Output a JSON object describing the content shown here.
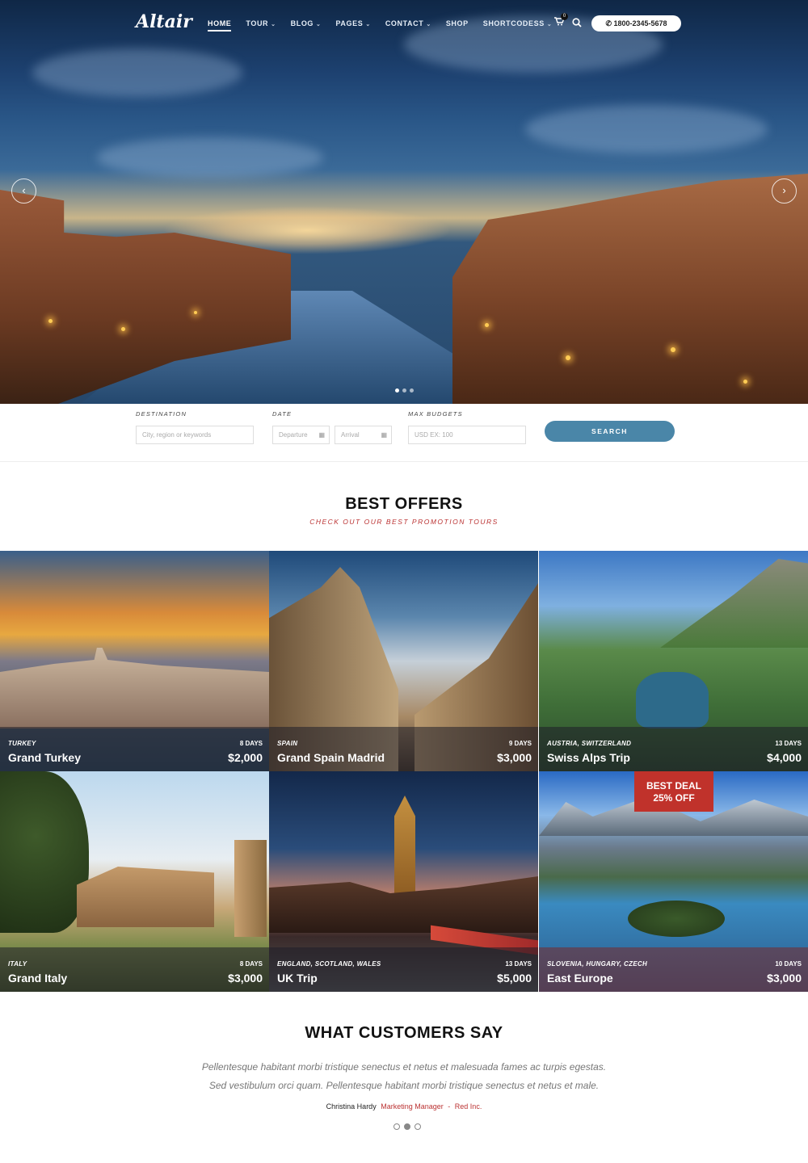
{
  "brand": {
    "logo": "Altair"
  },
  "nav": {
    "items": [
      {
        "label": "HOME",
        "active": true,
        "caret": false
      },
      {
        "label": "TOUR",
        "caret": true
      },
      {
        "label": "BLOG",
        "caret": true
      },
      {
        "label": "PAGES",
        "caret": true
      },
      {
        "label": "CONTACT",
        "caret": true
      },
      {
        "label": "SHOP",
        "caret": false
      },
      {
        "label": "SHORTCODESS",
        "caret": true
      }
    ],
    "cart_count": "0",
    "phone": "1800-2345-5678"
  },
  "slider": {
    "prev_icon": "chevron-left-icon",
    "next_icon": "chevron-right-icon",
    "slides": 3,
    "active_slide": 1
  },
  "search": {
    "destination_label": "DESTINATION",
    "destination_placeholder": "City, region or keywords",
    "date_label": "DATE",
    "departure_placeholder": "Departure",
    "arrival_placeholder": "Arrival",
    "budget_label": "MAX BUDGETS",
    "budget_placeholder": "USD EX: 100",
    "button": "SEARCH"
  },
  "offers": {
    "title": "BEST OFFERS",
    "subtitle": "CHECK OUT OUR BEST PROMOTION TOURS",
    "tours": [
      {
        "country": "TURKEY",
        "name": "Grand Turkey",
        "days": "8 DAYS",
        "price": "$2,000"
      },
      {
        "country": "SPAIN",
        "name": "Grand Spain Madrid",
        "days": "9 DAYS",
        "price": "$3,000"
      },
      {
        "country": "AUSTRIA, SWITZERLAND",
        "name": "Swiss Alps Trip",
        "days": "13 DAYS",
        "price": "$4,000"
      },
      {
        "country": "ITALY",
        "name": "Grand Italy",
        "days": "8 DAYS",
        "price": "$3,000"
      },
      {
        "country": "ENGLAND, SCOTLAND, WALES",
        "name": "UK Trip",
        "days": "13 DAYS",
        "price": "$5,000"
      },
      {
        "country": "SLOVENIA, HUNGARY, CZECH",
        "name": "East Europe",
        "days": "10 DAYS",
        "price": "$3,000",
        "deal_line1": "BEST DEAL",
        "deal_line2": "25% OFF"
      }
    ]
  },
  "testimonials": {
    "title": "WHAT CUSTOMERS SAY",
    "quote_line1": "Pellentesque habitant morbi tristique senectus et netus et malesuada fames ac turpis egestas.",
    "quote_line2": "Sed vestibulum orci quam. Pellentesque habitant morbi tristique senectus et netus et male.",
    "author": "Christina Hardy",
    "role": "Marketing Manager",
    "separator": "-",
    "company": "Red Inc.",
    "dots": 3,
    "active_dot": 1
  }
}
